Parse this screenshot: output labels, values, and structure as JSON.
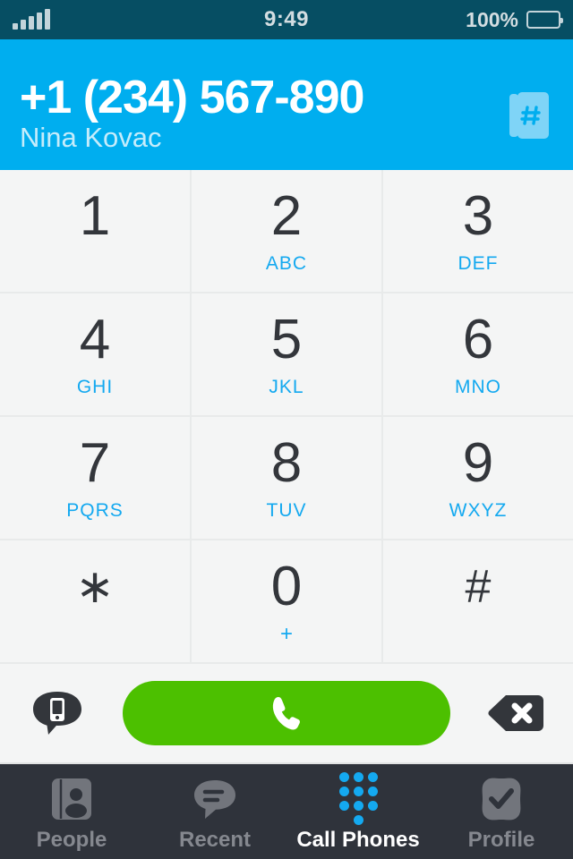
{
  "status_bar": {
    "signal_icon": "signal-bars-icon",
    "signal_strength": 5,
    "time": "9:49",
    "battery_percent": "100%",
    "battery_icon": "battery-full-icon",
    "background_color": "#064e63",
    "text_color": "#d3dde1"
  },
  "header": {
    "phone_number": "+1 (234) 567-890",
    "contact_name": "Nina Kovac",
    "contacts_icon": "contacts-book-hash-icon",
    "background_color": "#00aeef"
  },
  "keypad": {
    "keys": [
      {
        "digit": "1",
        "letters": ""
      },
      {
        "digit": "2",
        "letters": "ABC"
      },
      {
        "digit": "3",
        "letters": "DEF"
      },
      {
        "digit": "4",
        "letters": "GHI"
      },
      {
        "digit": "5",
        "letters": "JKL"
      },
      {
        "digit": "6",
        "letters": "MNO"
      },
      {
        "digit": "7",
        "letters": "PQRS"
      },
      {
        "digit": "8",
        "letters": "TUV"
      },
      {
        "digit": "9",
        "letters": "WXYZ"
      },
      {
        "digit": "∗",
        "letters": ""
      },
      {
        "digit": "0",
        "letters": "+"
      },
      {
        "digit": "#",
        "letters": ""
      }
    ],
    "digit_color": "#33363b",
    "letters_color": "#14a9f0",
    "key_background": "#f4f5f5"
  },
  "action_bar": {
    "message_icon": "sms-phone-bubble-icon",
    "call_icon": "phone-handset-icon",
    "call_button_color": "#4cc000",
    "backspace_icon": "backspace-delete-icon"
  },
  "tab_bar": {
    "active_tab": "Call Phones",
    "background_color": "#2f333b",
    "active_color": "#ffffff",
    "inactive_color": "#85888f",
    "tabs": [
      {
        "label": "People",
        "icon": "contact-card-icon"
      },
      {
        "label": "Recent",
        "icon": "chat-bubble-icon"
      },
      {
        "label": "Call Phones",
        "icon": "dialpad-dots-icon"
      },
      {
        "label": "Profile",
        "icon": "check-badge-icon"
      }
    ]
  }
}
